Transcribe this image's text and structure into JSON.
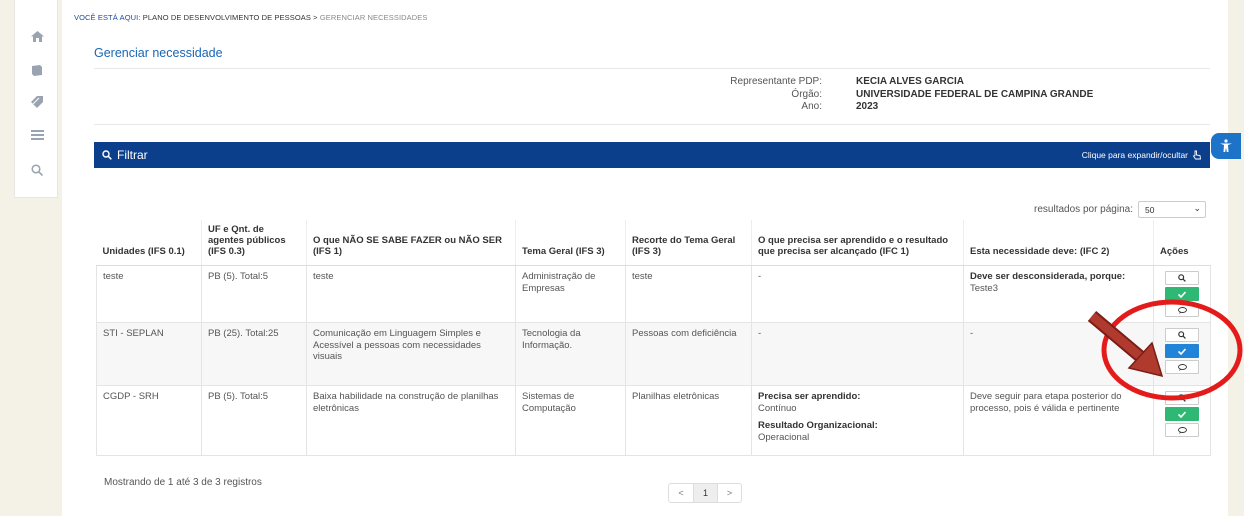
{
  "sidebar": {
    "icons": [
      "home-icon",
      "book-icon",
      "tag-icon",
      "list-icon",
      "search-icon"
    ]
  },
  "breadcrumb": {
    "prefix": "VOCÊ ESTÁ AQUI:",
    "parent": "PLANO DE DESENVOLVIMENTO DE PESSOAS >",
    "current": "GERENCIAR NECESSIDADES"
  },
  "page_title": "Gerenciar necessidade",
  "info": {
    "representante_label": "Representante PDP:",
    "representante_value": "KECIA ALVES GARCIA",
    "orgao_label": "Órgão:",
    "orgao_value": "UNIVERSIDADE FEDERAL DE CAMPINA GRANDE",
    "ano_label": "Ano:",
    "ano_value": "2023"
  },
  "filter": {
    "title": "Filtrar",
    "toggle": "Clique para expandir/ocultar"
  },
  "perpage": {
    "label": "resultados por página:",
    "value": "50"
  },
  "table": {
    "headers": [
      "Unidades (IFS 0.1)",
      "UF e Qnt. de agentes públicos (IFS 0.3)",
      "O que NÃO SE SABE FAZER ou NÃO SER (IFS 1)",
      "Tema Geral (IFS 3)",
      "Recorte do Tema Geral (IFS 3)",
      "O que precisa ser aprendido e o resultado que precisa ser alcançado (IFC 1)",
      "Esta necessidade deve: (IFC 2)",
      "Ações"
    ],
    "rows": [
      {
        "unidade": "teste",
        "uf": "PB (5). Total:5",
        "nao_sabe": "teste",
        "tema": "Administração de Empresas",
        "recorte": "teste",
        "aprender": "-",
        "deve_bold": "Deve ser desconsiderada, porque:",
        "deve_text": "Teste3"
      },
      {
        "unidade": "STI - SEPLAN",
        "uf": "PB (25). Total:25",
        "nao_sabe": "Comunicação em Linguagem Simples e Acessível a pessoas com necessidades visuais",
        "tema": "Tecnologia da Informação.",
        "recorte": "Pessoas com deficiência",
        "aprender": "-",
        "deve_text": "-"
      },
      {
        "unidade": "CGDP - SRH",
        "uf": "PB (5). Total:5",
        "nao_sabe": "Baixa habilidade na construção de planilhas eletrônicas",
        "tema": "Sistemas de Computação",
        "recorte": "Planilhas eletrônicas",
        "aprender_label1": "Precisa ser aprendido:",
        "aprender_val1": "Contínuo",
        "aprender_label2": "Resultado Organizacional:",
        "aprender_val2": "Operacional",
        "deve_text": "Deve seguir para etapa posterior do processo, pois é válida e pertinente"
      }
    ]
  },
  "footer": {
    "showing": "Mostrando de 1 até 3 de 3 registros",
    "prev": "<",
    "page": "1",
    "next": ">"
  },
  "colors": {
    "filter_bar": "#0b3f8c",
    "title_link": "#1a66b3",
    "approve_green": "#2eb873",
    "approve_blue": "#2184d8",
    "annotation_red": "#e31b1b",
    "arrow_brown": "#a8322b"
  }
}
